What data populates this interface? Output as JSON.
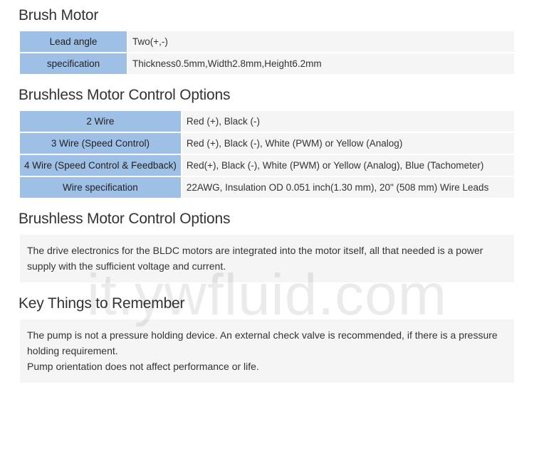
{
  "sections": {
    "brush": {
      "title": "Brush Motor",
      "rows": [
        {
          "label": "Lead angle",
          "value": "Two(+,-)"
        },
        {
          "label": "specification",
          "value": "Thickness0.5mm,Width2.8mm,Height6.2mm"
        }
      ]
    },
    "options": {
      "title": "Brushless Motor Control Options",
      "rows": [
        {
          "label": "2 Wire",
          "value": "Red (+), Black (-)"
        },
        {
          "label": "3 Wire (Speed Control)",
          "value": "Red (+), Black (-), White (PWM) or Yellow (Analog)"
        },
        {
          "label": "4 Wire (Speed Control & Feedback)",
          "value": "Red(+), Black (-), White (PWM) or Yellow (Analog), Blue (Tachometer)"
        },
        {
          "label": "Wire specification",
          "value": "22AWG, Insulation OD 0.051 inch(1.30 mm), 20\" (508 mm) Wire Leads"
        }
      ]
    },
    "options2": {
      "title": "Brushless Motor Control Options",
      "text": "The drive electronics for the BLDC motors are integrated into the motor itself, all that needed is a power supply with the sufficient voltage and current."
    },
    "key": {
      "title": "Key Things to Remember",
      "paragraphs": [
        "The pump is not a pressure holding device. An external check valve is recommended, if there is a pressure holding requirement.",
        "Pump orientation does not affect performance or life."
      ]
    }
  },
  "watermark": "it.ywfluid.com"
}
